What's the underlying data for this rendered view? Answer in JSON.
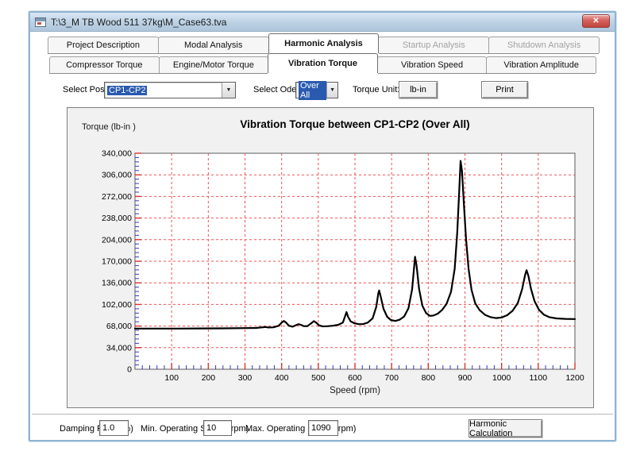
{
  "window": {
    "title": "T:\\3_M TB Wood 511 37kg\\M_Case63.tva",
    "close_glyph": "✕",
    "titlebar_color": "#bfd3e6",
    "border_color": "#8fb3d1"
  },
  "tabs_primary": [
    {
      "label": "Project Description",
      "state": "normal"
    },
    {
      "label": "Modal Analysis",
      "state": "normal"
    },
    {
      "label": "Harmonic Analysis",
      "state": "active"
    },
    {
      "label": "Startup Analysis",
      "state": "disabled"
    },
    {
      "label": "Shutdown Analysis",
      "state": "disabled"
    }
  ],
  "tabs_secondary": [
    {
      "label": "Compressor Torque",
      "state": "normal"
    },
    {
      "label": "Engine/Motor Torque",
      "state": "normal"
    },
    {
      "label": "Vibration Torque",
      "state": "active"
    },
    {
      "label": "Vibration Speed",
      "state": "normal"
    },
    {
      "label": "Vibration Amplitude",
      "state": "normal"
    }
  ],
  "controls": {
    "select_position_label": "Select Position:",
    "select_position_value": "CP1-CP2",
    "select_order_label": "Select Oder:",
    "select_order_value": "Over All",
    "torque_unit_label": "Torque Unit:",
    "torque_unit_button": "lb-in",
    "print_button": "Print",
    "dropdown_arrow": "▼",
    "highlight_color": "#2a5ab0"
  },
  "bottom": {
    "damping_label": "Damping Ratio (%)",
    "damping_value": "1.0",
    "min_speed_label": "Min. Operating Speed (rpm)",
    "min_speed_value": "10",
    "max_speed_label": "Max. Operating Speed (rpm)",
    "max_speed_value": "1090",
    "calc_button": "Harmonic Calculation"
  },
  "chart_data": {
    "type": "line",
    "title": "Vibration Torque between CP1-CP2 (Over All)",
    "ylabel": "Torque (lb-in )",
    "xlabel": "Speed (rpm)",
    "xlim": [
      0,
      1200
    ],
    "ylim": [
      0,
      340000
    ],
    "x_tick_values": [
      100,
      200,
      300,
      400,
      500,
      600,
      700,
      800,
      900,
      1000,
      1100,
      1200
    ],
    "x_tick_labels": [
      "100",
      "200",
      "300",
      "400",
      "500",
      "600",
      "700",
      "800",
      "900",
      "1000",
      "1100",
      "1200"
    ],
    "y_tick_values": [
      0,
      34000,
      68000,
      102000,
      136000,
      170000,
      204000,
      238000,
      272000,
      306000,
      340000
    ],
    "y_tick_labels": [
      "0",
      "34,000",
      "68,000",
      "102,000",
      "136,000",
      "170,000",
      "204,000",
      "238,000",
      "272,000",
      "306,000",
      "340,000"
    ],
    "x_minor_step": 20,
    "y_minor_step": 6800,
    "grid": {
      "on": true,
      "color": "#f25050",
      "style": "dashed"
    },
    "minor_tick_color": "#3434cc",
    "major_tick_color": "#e03030",
    "legend": "none",
    "series": [
      {
        "name": "vibration torque",
        "color": "#000000",
        "points": [
          [
            0,
            64000
          ],
          [
            60,
            64000
          ],
          [
            120,
            64000
          ],
          [
            180,
            64200
          ],
          [
            240,
            64400
          ],
          [
            300,
            64800
          ],
          [
            330,
            65000
          ],
          [
            348,
            66000
          ],
          [
            356,
            66500
          ],
          [
            364,
            65800
          ],
          [
            378,
            66000
          ],
          [
            392,
            68500
          ],
          [
            400,
            73500
          ],
          [
            406,
            76000
          ],
          [
            412,
            73500
          ],
          [
            420,
            68500
          ],
          [
            430,
            67000
          ],
          [
            440,
            69500
          ],
          [
            446,
            71000
          ],
          [
            452,
            70000
          ],
          [
            460,
            68000
          ],
          [
            470,
            67800
          ],
          [
            480,
            72000
          ],
          [
            488,
            75800
          ],
          [
            494,
            73500
          ],
          [
            502,
            69000
          ],
          [
            512,
            67500
          ],
          [
            525,
            67800
          ],
          [
            540,
            68500
          ],
          [
            555,
            70000
          ],
          [
            567,
            73500
          ],
          [
            574,
            85000
          ],
          [
            577,
            90000
          ],
          [
            581,
            83000
          ],
          [
            588,
            75500
          ],
          [
            598,
            72500
          ],
          [
            610,
            71000
          ],
          [
            622,
            71000
          ],
          [
            635,
            73500
          ],
          [
            648,
            80000
          ],
          [
            658,
            98000
          ],
          [
            664,
            120000
          ],
          [
            666,
            124000
          ],
          [
            670,
            115000
          ],
          [
            678,
            95000
          ],
          [
            688,
            82500
          ],
          [
            698,
            77500
          ],
          [
            710,
            76000
          ],
          [
            722,
            78000
          ],
          [
            734,
            83000
          ],
          [
            746,
            96000
          ],
          [
            756,
            126000
          ],
          [
            762,
            165000
          ],
          [
            764,
            177000
          ],
          [
            768,
            163000
          ],
          [
            775,
            126000
          ],
          [
            784,
            100000
          ],
          [
            794,
            88500
          ],
          [
            804,
            84000
          ],
          [
            814,
            84500
          ],
          [
            826,
            87500
          ],
          [
            838,
            93500
          ],
          [
            850,
            103000
          ],
          [
            862,
            122000
          ],
          [
            872,
            158000
          ],
          [
            879,
            215000
          ],
          [
            884,
            275000
          ],
          [
            888,
            328000
          ],
          [
            892,
            312000
          ],
          [
            897,
            262000
          ],
          [
            903,
            205000
          ],
          [
            910,
            158000
          ],
          [
            918,
            125000
          ],
          [
            928,
            104000
          ],
          [
            940,
            93000
          ],
          [
            955,
            85500
          ],
          [
            970,
            82000
          ],
          [
            985,
            80500
          ],
          [
            1000,
            81500
          ],
          [
            1015,
            85000
          ],
          [
            1030,
            92000
          ],
          [
            1044,
            104000
          ],
          [
            1056,
            126000
          ],
          [
            1064,
            148000
          ],
          [
            1068,
            156000
          ],
          [
            1073,
            147000
          ],
          [
            1080,
            127000
          ],
          [
            1090,
            107000
          ],
          [
            1102,
            93500
          ],
          [
            1115,
            86000
          ],
          [
            1130,
            82000
          ],
          [
            1150,
            80000
          ],
          [
            1175,
            79200
          ],
          [
            1200,
            79000
          ]
        ]
      }
    ]
  }
}
